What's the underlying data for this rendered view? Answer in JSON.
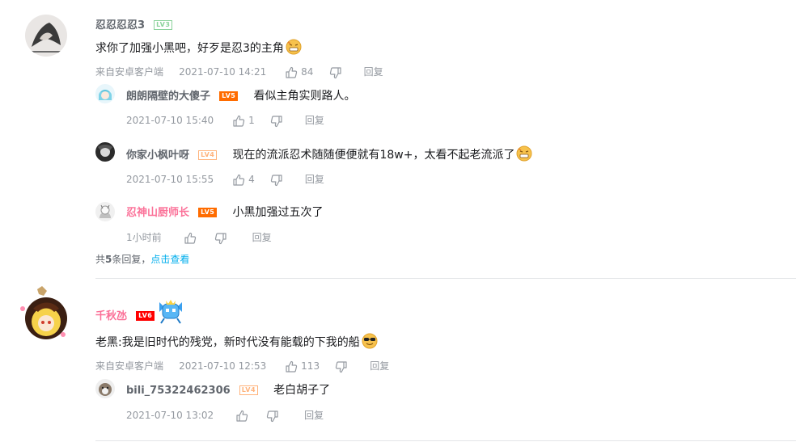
{
  "comments": [
    {
      "user": "忍忍忍忍3",
      "level": "LV3",
      "text": "求你了加强小黑吧，好歹是忍3的主角",
      "source": "来自安卓客户端",
      "time": "2021-07-10 14:21",
      "likes": "84",
      "reply_label": "回复",
      "replies": [
        {
          "user": "朗朗隔壁的大傻子",
          "level": "LV5",
          "text": "看似主角实则路人。",
          "time": "2021-07-10 15:40",
          "likes": "1",
          "reply_label": "回复"
        },
        {
          "user": "你家小枫叶呀",
          "level": "LV4",
          "text": "现在的流派忍术随随便便就有18w+，太看不起老流派了",
          "time": "2021-07-10 15:55",
          "likes": "4",
          "reply_label": "回复"
        },
        {
          "user": "忍神山厨师长",
          "level": "LV5",
          "text": "小黑加强过五次了",
          "time": "1小时前",
          "likes": "",
          "reply_label": "回复"
        }
      ],
      "more_replies": {
        "prefix": "共",
        "count": "5",
        "suffix": "条回复，",
        "link": "点击查看"
      }
    },
    {
      "user": "千秋氹",
      "level": "LV6",
      "text": "老黑:我是旧时代的残党，新时代没有能载的下我的船",
      "source": "来自安卓客户端",
      "time": "2021-07-10 12:53",
      "likes": "113",
      "reply_label": "回复",
      "replies": [
        {
          "user": "bili_75322462306",
          "level": "LV4",
          "text": "老白胡子了",
          "time": "2021-07-10 13:02",
          "likes": "",
          "reply_label": "回复"
        }
      ]
    }
  ],
  "colors": {
    "lv3": "#8bd29b",
    "lv4": "#ffb37c",
    "lv5": "#ff6c00",
    "lv6": "#ff0000",
    "accent": "#00aeec",
    "vip_name": "#fb7299",
    "muted": "#9499a0"
  },
  "icons": [
    "like-icon",
    "dislike-icon",
    "grimace-emoji",
    "sunglasses-emoji",
    "badge-icon"
  ]
}
